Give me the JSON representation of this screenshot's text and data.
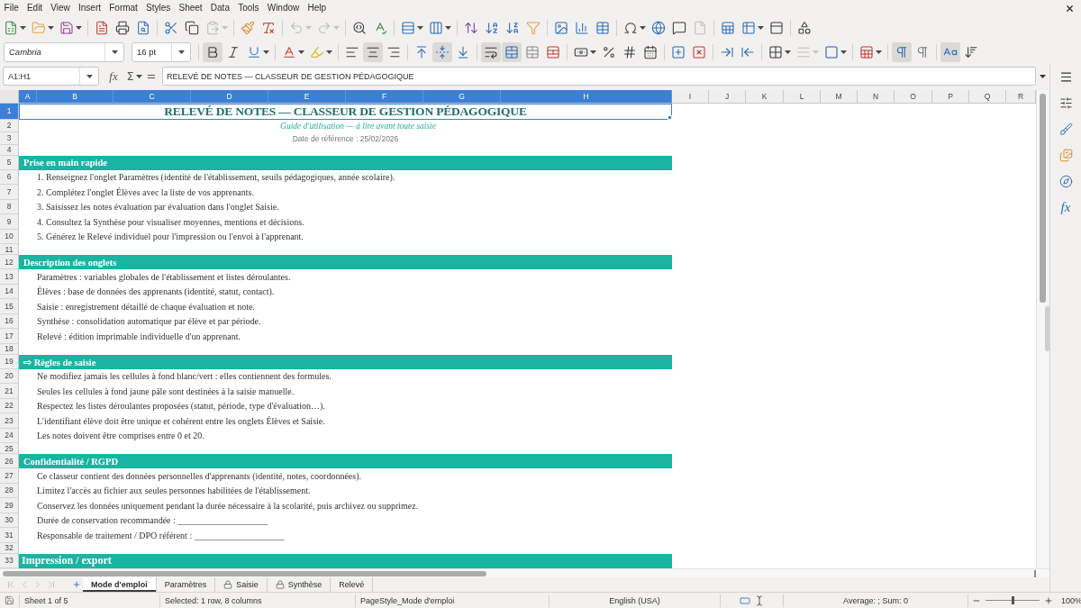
{
  "menu_bar": [
    "File",
    "Edit",
    "View",
    "Insert",
    "Format",
    "Styles",
    "Sheet",
    "Data",
    "Tools",
    "Window",
    "Help"
  ],
  "standard_toolbar": [
    [
      {
        "kind": "new",
        "disabled": false
      },
      {
        "kind": "open",
        "disabled": false
      },
      {
        "kind": "save",
        "disabled": false
      }
    ],
    [
      {
        "kind": "export_pdf",
        "disabled": false
      },
      {
        "kind": "print",
        "disabled": false
      },
      {
        "kind": "print_preview",
        "disabled": false
      }
    ],
    [
      {
        "kind": "cut",
        "disabled": false
      },
      {
        "kind": "copy",
        "disabled": false
      },
      {
        "kind": "paste",
        "disabled": true
      }
    ],
    [
      {
        "kind": "clone_formatting",
        "disabled": false
      },
      {
        "kind": "clear_formatting",
        "disabled": false
      }
    ],
    [
      {
        "kind": "undo",
        "disabled": true
      },
      {
        "kind": "redo",
        "disabled": true
      }
    ],
    [
      {
        "kind": "find_replace",
        "disabled": false
      },
      {
        "kind": "spelling",
        "disabled": false
      }
    ],
    [
      {
        "kind": "rows",
        "disabled": false
      },
      {
        "kind": "columns",
        "disabled": false
      }
    ],
    [
      {
        "kind": "sort",
        "disabled": false
      },
      {
        "kind": "sort_ascending",
        "disabled": false
      },
      {
        "kind": "sort_descending",
        "disabled": false
      },
      {
        "kind": "autofilter",
        "disabled": false
      }
    ],
    [
      {
        "kind": "image",
        "disabled": false
      },
      {
        "kind": "chart",
        "disabled": false
      },
      {
        "kind": "pivot_table",
        "disabled": false
      }
    ],
    [
      {
        "kind": "special_character",
        "disabled": false
      },
      {
        "kind": "hyperlink",
        "disabled": false
      },
      {
        "kind": "comment",
        "disabled": false
      },
      {
        "kind": "header_footer",
        "disabled": true
      }
    ],
    [
      {
        "kind": "print_area",
        "disabled": false
      },
      {
        "kind": "freeze",
        "disabled": false
      },
      {
        "kind": "split_window",
        "disabled": false
      }
    ],
    [
      {
        "kind": "draw_functions",
        "disabled": false
      }
    ]
  ],
  "formatting_toolbar": {
    "font_name": "Cambria",
    "font_size": "16 pt",
    "groups": [
      [
        {
          "kind": "bold",
          "pressed": true,
          "disabled": false
        },
        {
          "kind": "italic",
          "pressed": false,
          "disabled": false
        },
        {
          "kind": "underline",
          "pressed": false,
          "disabled": false
        }
      ],
      [
        {
          "kind": "font_color",
          "pressed": false,
          "disabled": false
        },
        {
          "kind": "highlight",
          "pressed": false,
          "disabled": false
        }
      ],
      [
        {
          "kind": "align_left",
          "pressed": false,
          "disabled": false
        },
        {
          "kind": "align_center",
          "pressed": true,
          "disabled": false
        },
        {
          "kind": "align_right",
          "pressed": false,
          "disabled": false
        }
      ],
      [
        {
          "kind": "align_top",
          "pressed": false,
          "disabled": false
        },
        {
          "kind": "align_middle",
          "pressed": true,
          "disabled": false
        },
        {
          "kind": "align_bottom",
          "pressed": false,
          "disabled": false
        }
      ],
      [
        {
          "kind": "wrap_text",
          "pressed": true,
          "disabled": false
        },
        {
          "kind": "merge_center",
          "pressed": true,
          "disabled": false
        },
        {
          "kind": "merge_cells",
          "pressed": false,
          "disabled": false
        },
        {
          "kind": "unmerge_cells",
          "pressed": false,
          "disabled": false
        }
      ],
      [
        {
          "kind": "currency",
          "pressed": false,
          "disabled": false
        },
        {
          "kind": "percent",
          "pressed": false,
          "disabled": false
        },
        {
          "kind": "number",
          "pressed": false,
          "disabled": false
        },
        {
          "kind": "date",
          "pressed": false,
          "disabled": false
        }
      ],
      [
        {
          "kind": "add_decimal",
          "pressed": false,
          "disabled": false
        },
        {
          "kind": "delete_decimal",
          "pressed": false,
          "disabled": false
        }
      ],
      [
        {
          "kind": "increase_indent",
          "pressed": false,
          "disabled": false
        },
        {
          "kind": "decrease_indent",
          "pressed": false,
          "disabled": false
        }
      ],
      [
        {
          "kind": "borders",
          "pressed": false,
          "disabled": false
        },
        {
          "kind": "border_style",
          "pressed": false,
          "disabled": true
        },
        {
          "kind": "border_color",
          "pressed": false,
          "disabled": false
        }
      ],
      [
        {
          "kind": "conditional",
          "pressed": false,
          "disabled": false
        }
      ],
      [
        {
          "kind": "left_to_right",
          "pressed": true,
          "disabled": false
        },
        {
          "kind": "right_to_left",
          "pressed": false,
          "disabled": false
        }
      ],
      [
        {
          "kind": "text_horizontal",
          "pressed": true,
          "disabled": false
        },
        {
          "kind": "text_vertical",
          "pressed": false,
          "disabled": false
        }
      ]
    ]
  },
  "formula_bar": {
    "name_box": "A1:H1",
    "function_wizard": "fx",
    "sum": "Σ",
    "equals": "=",
    "content": "RELEVÉ DE NOTES — CLASSEUR DE GESTION PÉDAGOGIQUE"
  },
  "sidebar": {
    "functions": "fx"
  },
  "columns": [
    {
      "label": "A",
      "selected": true
    },
    {
      "label": "B",
      "selected": true
    },
    {
      "label": "C",
      "selected": true
    },
    {
      "label": "D",
      "selected": true
    },
    {
      "label": "E",
      "selected": true
    },
    {
      "label": "F",
      "selected": true
    },
    {
      "label": "G",
      "selected": true
    },
    {
      "label": "H",
      "selected": true
    },
    {
      "label": "I",
      "selected": false
    },
    {
      "label": "J",
      "selected": false
    },
    {
      "label": "K",
      "selected": false
    },
    {
      "label": "L",
      "selected": false
    },
    {
      "label": "M",
      "selected": false
    },
    {
      "label": "N",
      "selected": false
    },
    {
      "label": "O",
      "selected": false
    },
    {
      "label": "P",
      "selected": false
    },
    {
      "label": "Q",
      "selected": false
    },
    {
      "label": "R",
      "selected": false
    }
  ],
  "rows": [
    {
      "number": "1",
      "selected": true,
      "kind": "title",
      "text": "RELEVÉ DE NOTES — CLASSEUR DE GESTION PÉDAGOGIQUE"
    },
    {
      "number": "2",
      "selected": false,
      "kind": "subtitle",
      "text": "Guide d'utilisation — à lire avant toute saisie"
    },
    {
      "number": "3",
      "selected": false,
      "kind": "date",
      "text": "Date de référence : 25/02/2026"
    },
    {
      "number": "4",
      "selected": false,
      "kind": "empty"
    },
    {
      "number": "5",
      "selected": false,
      "kind": "section",
      "text": "Prise en main rapide"
    },
    {
      "number": "6",
      "selected": false,
      "kind": "item",
      "text": "1. Renseignez l'onglet Paramètres (identité de l'établissement, seuils pédagogiques, année scolaire)."
    },
    {
      "number": "7",
      "selected": false,
      "kind": "item",
      "text": "2. Complétez l'onglet Élèves avec la liste de vos apprenants."
    },
    {
      "number": "8",
      "selected": false,
      "kind": "item",
      "text": "3. Saisissez les notes évaluation par évaluation dans l'onglet Saisie."
    },
    {
      "number": "9",
      "selected": false,
      "kind": "item",
      "text": "4. Consultez la Synthèse pour visualiser moyennes, mentions et décisions."
    },
    {
      "number": "10",
      "selected": false,
      "kind": "item",
      "text": "5. Générez le Relevé individuel pour l'impression ou l'envoi à l'apprenant."
    },
    {
      "number": "11",
      "selected": false,
      "kind": "empty"
    },
    {
      "number": "12",
      "selected": false,
      "kind": "section",
      "text": "Description des onglets"
    },
    {
      "number": "13",
      "selected": false,
      "kind": "item",
      "text": "Paramètres : variables globales de l'établissement et listes déroulantes."
    },
    {
      "number": "14",
      "selected": false,
      "kind": "item",
      "text": "Élèves : base de données des apprenants (identité, statut, contact)."
    },
    {
      "number": "15",
      "selected": false,
      "kind": "item",
      "text": "Saisie : enregistrement détaillé de chaque évaluation et note."
    },
    {
      "number": "16",
      "selected": false,
      "kind": "item",
      "text": "Synthèse : consolidation automatique par élève et par période."
    },
    {
      "number": "17",
      "selected": false,
      "kind": "item",
      "text": "Relevé : édition imprimable individuelle d'un apprenant."
    },
    {
      "number": "18",
      "selected": false,
      "kind": "empty"
    },
    {
      "number": "19",
      "selected": false,
      "kind": "section",
      "text": "⇨ Règles de saisie"
    },
    {
      "number": "20",
      "selected": false,
      "kind": "item",
      "text": "Ne modifiez jamais les cellules à fond blanc/vert : elles contiennent des formules."
    },
    {
      "number": "21",
      "selected": false,
      "kind": "item",
      "text": "Seules les cellules à fond jaune pâle sont destinées à la saisie manuelle."
    },
    {
      "number": "22",
      "selected": false,
      "kind": "item",
      "text": "Respectez les listes déroulantes proposées (statut, période, type d'évaluation…)."
    },
    {
      "number": "23",
      "selected": false,
      "kind": "item",
      "text": "L'identifiant élève doit être unique et cohérent entre les onglets Élèves et Saisie."
    },
    {
      "number": "24",
      "selected": false,
      "kind": "item",
      "text": "Les notes doivent être comprises entre 0 et 20."
    },
    {
      "number": "25",
      "selected": false,
      "kind": "empty"
    },
    {
      "number": "26",
      "selected": false,
      "kind": "section",
      "text": "Confidentialité / RGPD"
    },
    {
      "number": "27",
      "selected": false,
      "kind": "item",
      "text": "Ce classeur contient des données personnelles d'apprenants (identité, notes, coordonnées)."
    },
    {
      "number": "28",
      "selected": false,
      "kind": "item",
      "text": "Limitez l'accès au fichier aux seules personnes habilitées de l'établissement."
    },
    {
      "number": "29",
      "selected": false,
      "kind": "item",
      "text": "Conservez les données uniquement pendant la durée nécessaire à la scolarité, puis archivez ou supprimez."
    },
    {
      "number": "30",
      "selected": false,
      "kind": "item",
      "text": "Durée de conservation recommandée : ____________________"
    },
    {
      "number": "31",
      "selected": false,
      "kind": "item",
      "text": "Responsable de traitement / DPO référent : ____________________"
    },
    {
      "number": "32",
      "selected": false,
      "kind": "empty"
    },
    {
      "number": "33",
      "selected": false,
      "kind": "banner",
      "text": "Impression / export"
    }
  ],
  "sheet_navigation": [
    {
      "kind": "first",
      "disabled": true
    },
    {
      "kind": "previous",
      "disabled": true
    },
    {
      "kind": "next",
      "disabled": true
    },
    {
      "kind": "last",
      "disabled": true
    }
  ],
  "sheet_tabs": [
    {
      "label": "Mode d'emploi",
      "selected": true,
      "locked": false
    },
    {
      "label": "Paramètres",
      "selected": false,
      "locked": false
    },
    {
      "label": "Saisie",
      "selected": false,
      "locked": true
    },
    {
      "label": "Synthèse",
      "selected": false,
      "locked": true
    },
    {
      "label": "Relevé",
      "selected": false,
      "locked": false
    }
  ],
  "status_bar": {
    "sheet": "Sheet 1 of 5",
    "selection": "Selected: 1 row, 8 columns",
    "page_style": "PageStyle_Mode d'emploi",
    "language": "English (USA)",
    "summary": "Average: ; Sum: 0",
    "zoom": {
      "level": 0.5,
      "reading": "100%"
    }
  }
}
